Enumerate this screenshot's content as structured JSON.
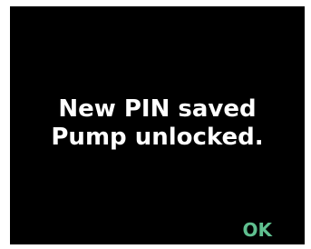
{
  "message": {
    "line1": "New PIN saved",
    "line2": "Pump unlocked."
  },
  "softkeys": {
    "ok_label": "OK"
  },
  "colors": {
    "screen_background": "#000000",
    "text": "#ffffff",
    "ok_accent": "#5fbf8f",
    "frame": "#ffffff"
  }
}
